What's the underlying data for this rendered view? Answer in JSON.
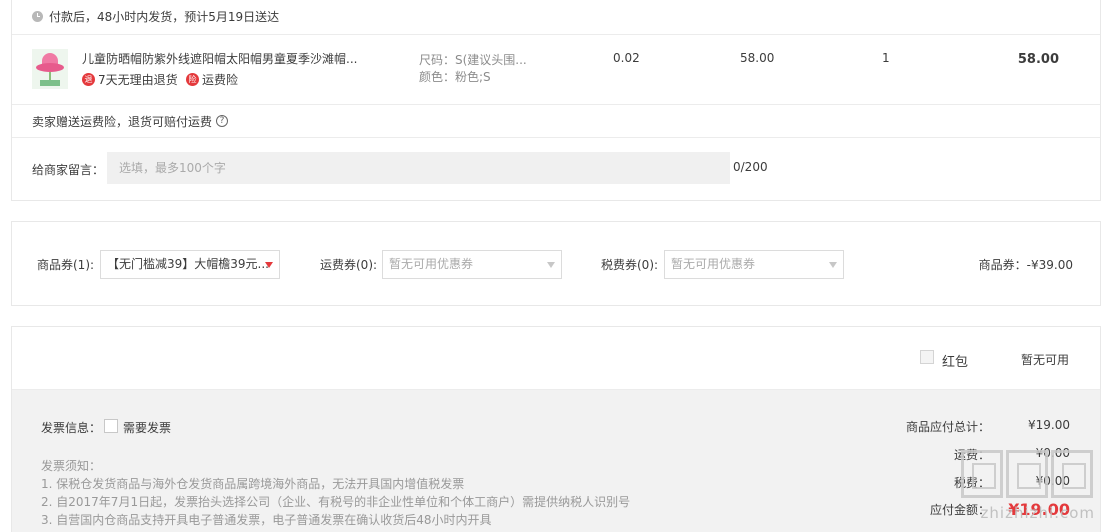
{
  "shipping_notice": "付款后，48小时内发货，预计5月19日送达",
  "item": {
    "title": "儿童防晒帽防紫外线遮阳帽太阳帽男童夏季沙滩帽...",
    "service_return": "7天无理由退货",
    "service_shipping": "运费险",
    "spec_size": "尺码：S(建议头围...",
    "spec_color": "颜色：粉色;S",
    "tax": "0.02",
    "price": "58.00",
    "quantity": "1",
    "subtotal": "58.00",
    "badge_return": "退",
    "badge_shipping": "险"
  },
  "free_insurance": "卖家赠送运费险，退货可赔付运费",
  "help_mark": "?",
  "message": {
    "label": "给商家留言：",
    "placeholder": "选填，最多100个字",
    "count": "0/200"
  },
  "coupons": {
    "goods_label": "商品券(1):",
    "goods_value": "【无门槛减39】大帽檐39元...",
    "shipping_label": "运费券(0):",
    "shipping_value": "暂无可用优惠券",
    "tax_label": "税费券(0):",
    "tax_value": "暂无可用优惠券",
    "total": "商品券：-¥39.00"
  },
  "red_packet": {
    "label": "红包",
    "status": "暂无可用"
  },
  "invoice": {
    "label": "发票信息：",
    "need": "需要发票",
    "notes_title": "发票须知：",
    "notes": [
      "1. 保税仓发货商品与海外仓发货商品属跨境海外商品，无法开具国内增值税发票",
      "2. 自2017年7月1日起，发票抬头选择公司（企业、有税号的非企业性单位和个体工商户）需提供纳税人识别号",
      "3. 自营国内仓商品支持开具电子普通发票，电子普通发票在确认收货后48小时内开具"
    ]
  },
  "summary": {
    "goods_total_label": "商品应付总计：",
    "goods_total": "¥19.00",
    "shipping_label": "运费：",
    "shipping": "¥0.00",
    "tax_label": "税费：",
    "tax": "¥0.00",
    "payable_label": "应付金额：",
    "payable": "¥19.00"
  },
  "watermark": "zhizhizhi.com",
  "colors": {
    "accent_red": "#e4393c",
    "border": "#e8e8e8",
    "summary_bg": "#f2f2f2"
  }
}
